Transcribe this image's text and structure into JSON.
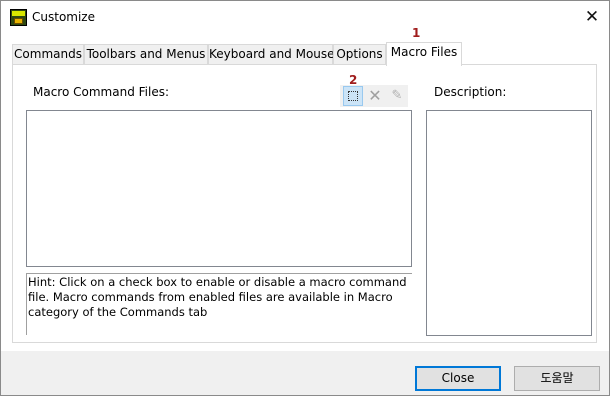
{
  "window": {
    "title": "Customize",
    "icon_name": "pads-app-icon",
    "close_glyph": "✕"
  },
  "tabs": [
    {
      "label": "Commands"
    },
    {
      "label": "Toolbars and Menus"
    },
    {
      "label": "Keyboard and Mouse"
    },
    {
      "label": "Options"
    },
    {
      "label": "Macro Files",
      "active": true
    }
  ],
  "markers": {
    "one": "1",
    "two": "2"
  },
  "macro": {
    "label": "Macro Command Files:",
    "toolbar": {
      "add_icon": "new-item-icon",
      "delete_icon": "delete-icon",
      "delete_glyph": "✕",
      "edit_icon": "edit-pencil-icon",
      "edit_glyph": "✎"
    },
    "hint_lines": [
      "Hint: Click on a check box to enable or disable a  macro command",
      "file. Macro commands from enabled files are available in Macro",
      "category of the Commands tab"
    ]
  },
  "description": {
    "label": "Description:"
  },
  "buttons": {
    "close": "Close",
    "help": "도움말"
  },
  "colors": {
    "marker": "#a01c1c",
    "focus_border": "#0078d7",
    "selected_button": "#cce4f7"
  }
}
